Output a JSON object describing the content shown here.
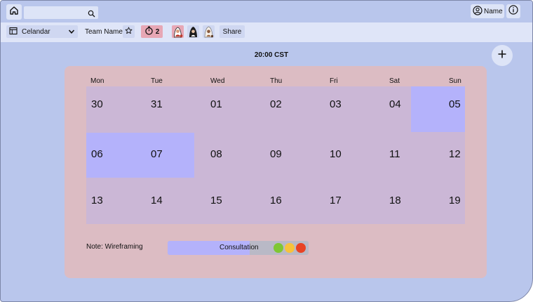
{
  "topbar": {
    "home_icon": "home-icon",
    "search": {
      "value": "",
      "icon": "search-icon"
    },
    "user_label": "Name",
    "info_icon": "info-icon"
  },
  "toolbar": {
    "view_select": "Celandar",
    "team_name": "Team Name",
    "timer_count": "2",
    "share_label": "Share"
  },
  "header": {
    "time": "20:00 CST"
  },
  "calendar": {
    "weekdays": [
      "Mon",
      "Tue",
      "Wed",
      "Thu",
      "Fri",
      "Sat",
      "Sun"
    ],
    "weeks": [
      [
        "30",
        "31",
        "01",
        "02",
        "03",
        "04",
        "05"
      ],
      [
        "06",
        "07",
        "08",
        "09",
        "10",
        "11",
        "12"
      ],
      [
        "13",
        "14",
        "15",
        "16",
        "17",
        "18",
        "19"
      ]
    ],
    "highlighted_days": [
      "05",
      "06",
      "07"
    ]
  },
  "note": "Note: Wireframing",
  "event": {
    "label": "Consultation",
    "progress_fraction": 0.58,
    "status_colors": [
      "#7fc733",
      "#f7c23c",
      "#e84325"
    ]
  },
  "colors": {
    "background": "#b9c6ec",
    "card": "#dcbcc3",
    "grid": "#cbb7d6",
    "highlight": "#b4b2fb",
    "timer_badge": "#e7a7b5"
  }
}
